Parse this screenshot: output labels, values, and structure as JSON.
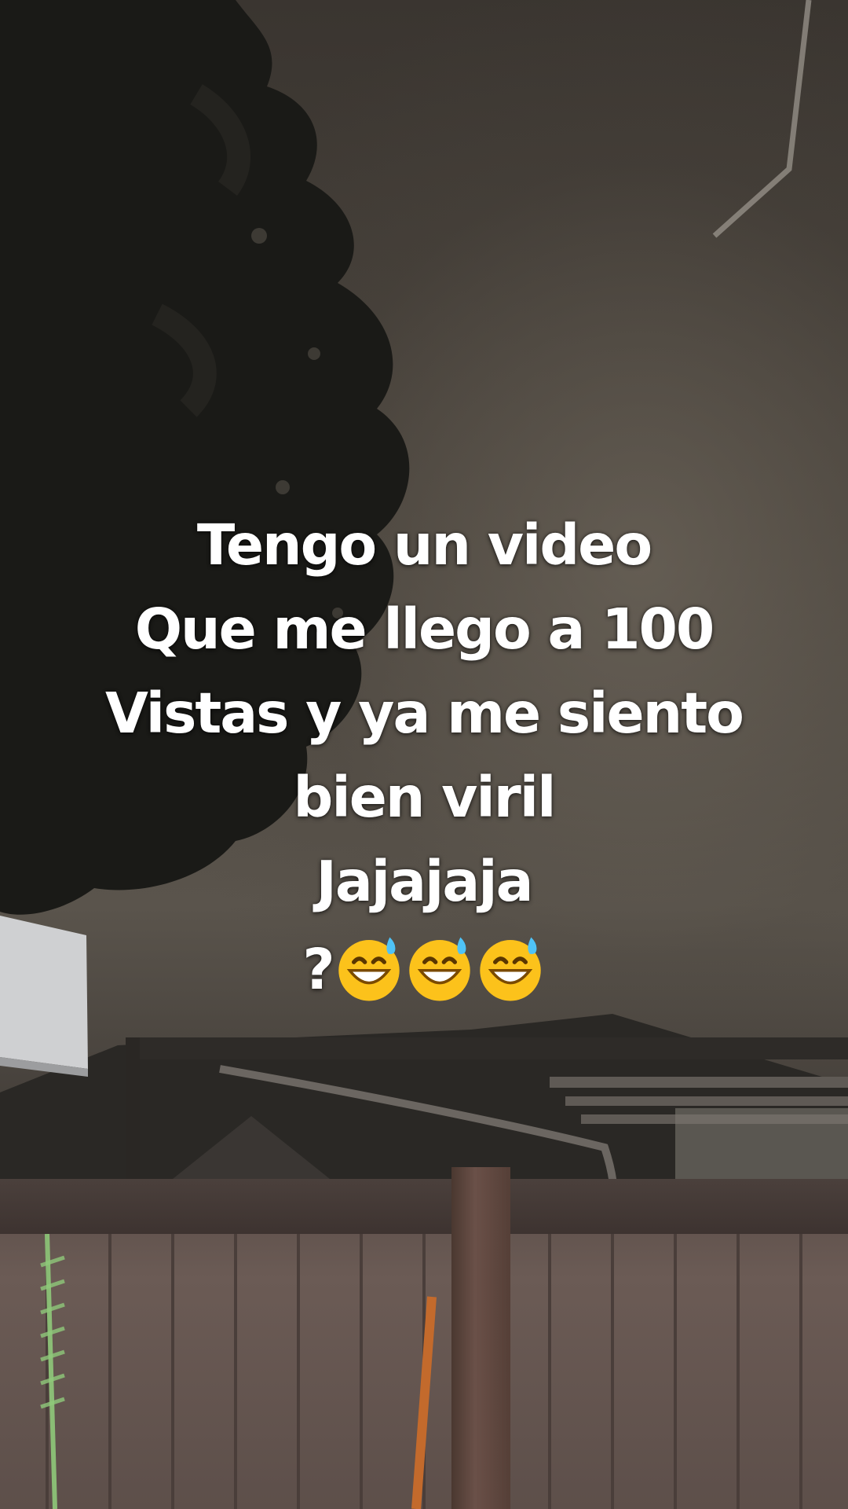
{
  "caption": {
    "lines": [
      "Tengo un video",
      "Que me llego a 100",
      "Vistas y ya me siento",
      "bien viril",
      "Jajajaja"
    ],
    "emoji_prefix": "?",
    "emoji_icon": "grinning-sweat-face-icon",
    "emoji_count": 3
  },
  "colors": {
    "caption_text": "#ffffff",
    "sky": "#4a443d",
    "fence": "#6b5b55"
  }
}
